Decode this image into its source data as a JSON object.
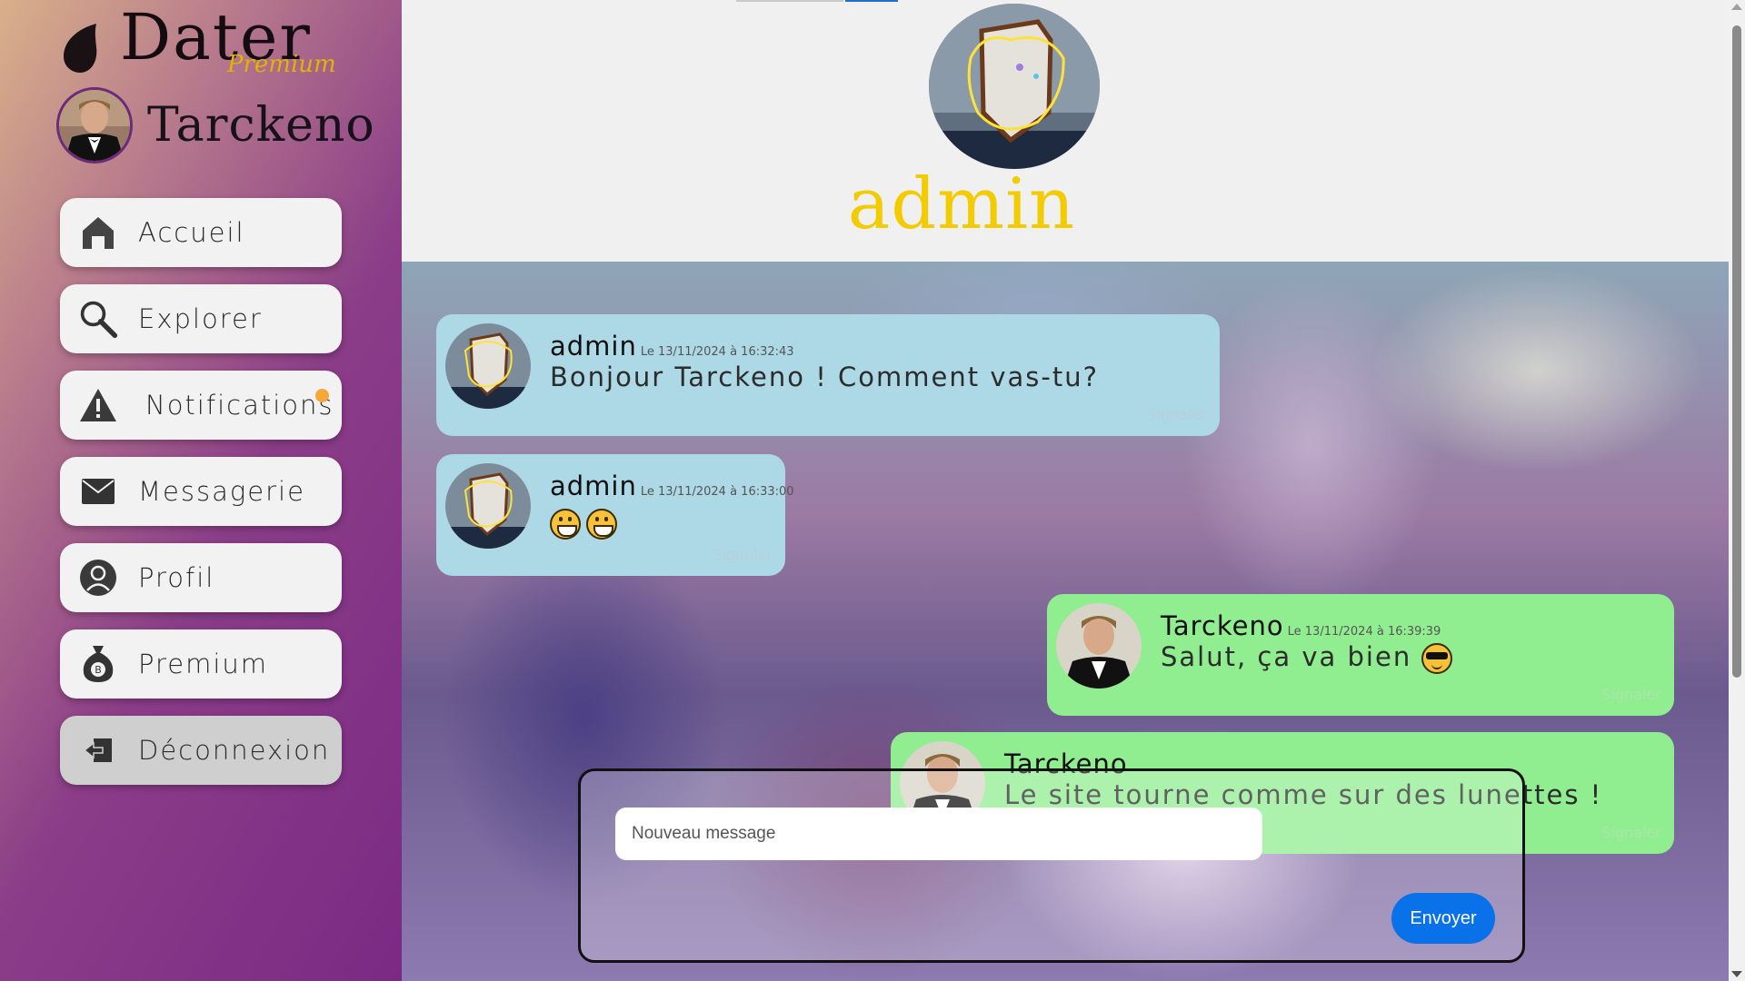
{
  "brand": {
    "name": "Dater",
    "tier": "Premium"
  },
  "current_user": {
    "name": "Tarckeno"
  },
  "nav": {
    "items": [
      {
        "label": "Accueil",
        "icon": "home-icon"
      },
      {
        "label": "Explorer",
        "icon": "search-icon"
      },
      {
        "label": "Notifications",
        "icon": "warning-icon",
        "has_badge": true
      },
      {
        "label": "Messagerie",
        "icon": "mail-icon"
      },
      {
        "label": "Profil",
        "icon": "user-icon"
      },
      {
        "label": "Premium",
        "icon": "money-bag-icon"
      },
      {
        "label": "Déconnexion",
        "icon": "logout-icon"
      }
    ]
  },
  "conversation": {
    "contact_name": "admin"
  },
  "messages": [
    {
      "author": "admin",
      "timestamp": "Le 13/11/2024 à 16:32:43",
      "text": "Bonjour Tarckeno ! Comment vas-tu?",
      "report_label": "Signaler",
      "side": "other"
    },
    {
      "author": "admin",
      "timestamp": "Le 13/11/2024 à 16:33:00",
      "text": "",
      "emojis": [
        "grinning-face",
        "grinning-face"
      ],
      "report_label": "Signaler",
      "side": "other"
    },
    {
      "author": "Tarckeno",
      "timestamp": "Le 13/11/2024 à 16:39:39",
      "text": "Salut, ça va bien",
      "emojis": [
        "sunglasses-face"
      ],
      "report_label": "Signaler",
      "side": "me"
    },
    {
      "author": "Tarckeno",
      "timestamp": "",
      "text": "Le site tourne comme sur des lunettes !",
      "report_label": "Signaler",
      "side": "me"
    }
  ],
  "composer": {
    "placeholder": "Nouveau message",
    "value": "",
    "send_label": "Envoyer"
  },
  "colors": {
    "accent": "#f2cb00",
    "bubble_other": "#add8e6",
    "bubble_me": "#90ee90",
    "send_button": "#0a72e8",
    "badge": "#f5a73a"
  }
}
